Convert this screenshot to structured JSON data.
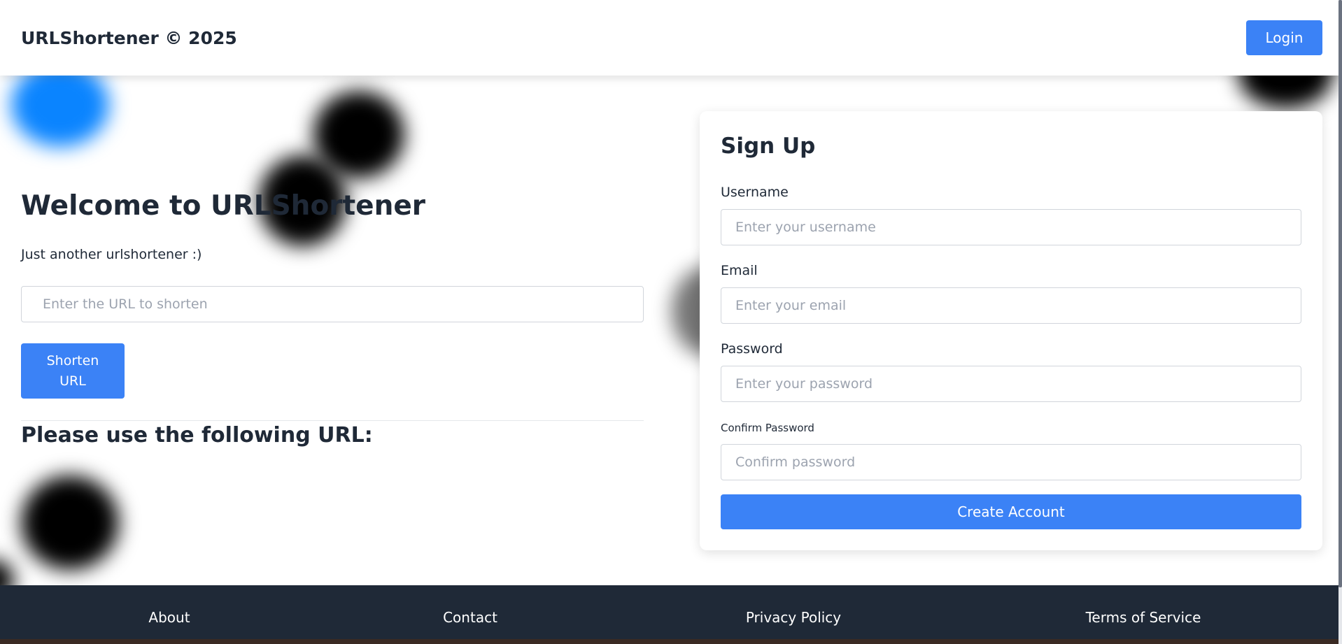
{
  "header": {
    "brand": "URLShortener © 2025",
    "login_label": "Login"
  },
  "hero": {
    "title": "Welcome to URLShortener",
    "tagline": "Just another urlshortener :)",
    "url_placeholder": "Enter the URL to shorten",
    "shorten_label": "Shorten URL",
    "result_heading": "Please use the following URL:"
  },
  "signup": {
    "title": "Sign Up",
    "username_label": "Username",
    "username_placeholder": "Enter your username",
    "email_label": "Email",
    "email_placeholder": "Enter your email",
    "password_label": "Password",
    "password_placeholder": "Enter your password",
    "confirm_label": "Confirm Password",
    "confirm_placeholder": "Confirm password",
    "submit_label": "Create Account"
  },
  "footer": {
    "links": [
      "About",
      "Contact",
      "Privacy Policy",
      "Terms of Service"
    ]
  },
  "colors": {
    "accent": "#3b82f6",
    "footer_bg": "#1f2937",
    "text": "#1f2937",
    "blob_blue": "#0a84ff",
    "blob_dark": "#000000"
  }
}
